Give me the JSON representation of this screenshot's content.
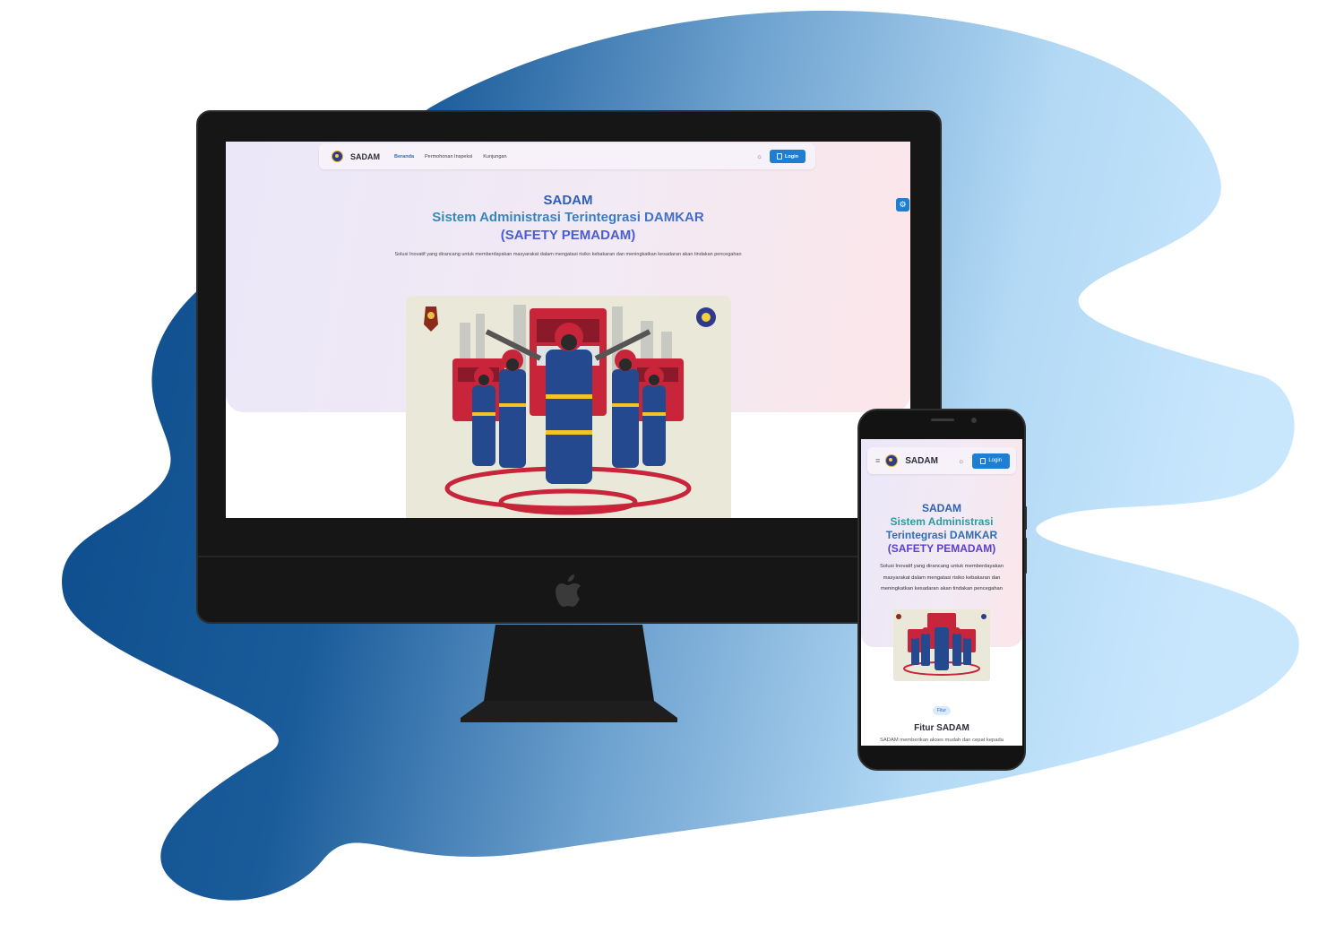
{
  "brand": "SADAM",
  "desktop": {
    "nav": {
      "links": [
        "Beranda",
        "Permohonan Inspeksi",
        "Kunjungan"
      ],
      "login_label": "Login"
    },
    "hero": {
      "title_line1": "SADAM",
      "title_line2": "Sistem Administrasi Terintegrasi DAMKAR",
      "title_line3": "(SAFETY PEMADAM)",
      "subtitle": "Solusi Inovatif yang dirancang untuk memberdayakan masyarakat dalam mengatasi risiko kebakaran dan meningkatkan kesadaran akan tindakan pencegahan"
    }
  },
  "mobile": {
    "nav": {
      "login_label": "Login"
    },
    "hero": {
      "line1": "SADAM",
      "line2": "Sistem Administrasi",
      "line3": "Terintegrasi DAMKAR",
      "line4": "(SAFETY PEMADAM)",
      "subtitle": "Solusi Inovatif yang dirancang untuk memberdayakan masyarakat dalam mengatasi risiko kebakaran dan meningkatkan kesadaran akan tindakan pencegahan"
    },
    "features": {
      "pill": "Fitur",
      "title": "Fitur SADAM",
      "subtitle": "SADAM memberikan akses mudah dan cepat kepada"
    }
  },
  "colors": {
    "accent": "#1e7ed1",
    "blob_dark": "#0d4f8f",
    "blob_light": "#c3e4fb"
  },
  "icons": [
    "apple-logo-icon",
    "sun-icon",
    "login-icon",
    "gear-icon",
    "menu-icon",
    "sadam-logo-icon"
  ]
}
